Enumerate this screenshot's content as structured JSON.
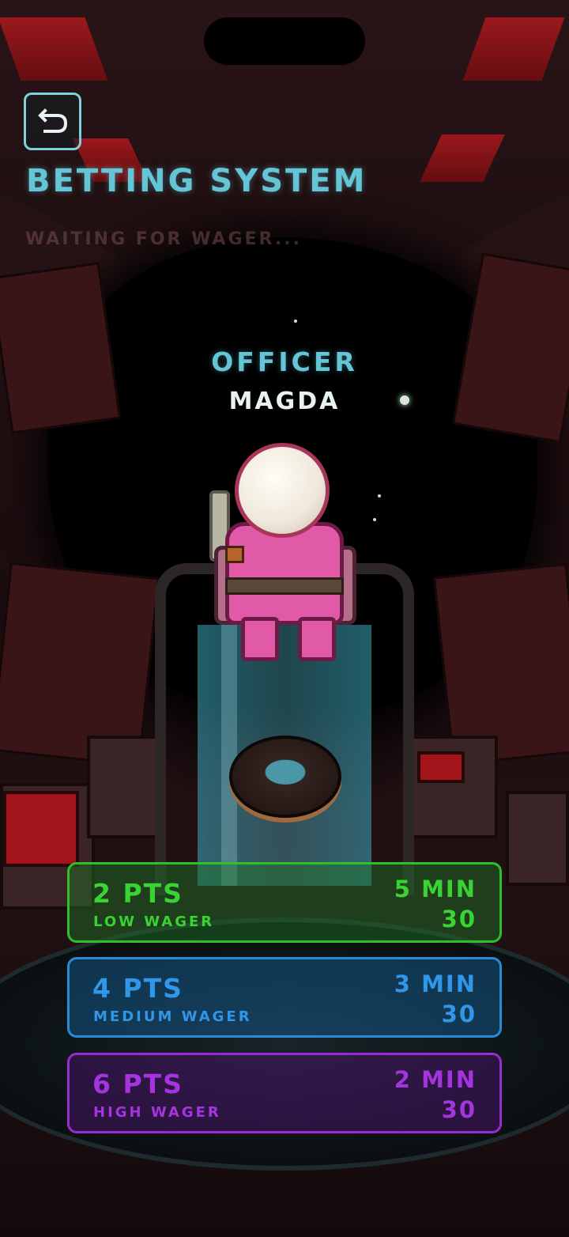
{
  "header": {
    "title": "BETTING SYSTEM",
    "status": "WAITING FOR WAGER..."
  },
  "character": {
    "rank": "OFFICER",
    "name": "MAGDA"
  },
  "wagers": [
    {
      "points": "2 PTS",
      "label": "LOW WAGER",
      "minutes": "5 MIN",
      "seconds": "30",
      "color": "#39d334"
    },
    {
      "points": "4 PTS",
      "label": "MEDIUM WAGER",
      "minutes": "3 MIN",
      "seconds": "30",
      "color": "#2f96e8"
    },
    {
      "points": "6 PTS",
      "label": "HIGH WAGER",
      "minutes": "2 MIN",
      "seconds": "30",
      "color": "#a534e0"
    }
  ],
  "icons": {
    "back": "back-arrow-icon"
  },
  "colors": {
    "accent": "#64c5d6",
    "background": "#1c0e10"
  }
}
